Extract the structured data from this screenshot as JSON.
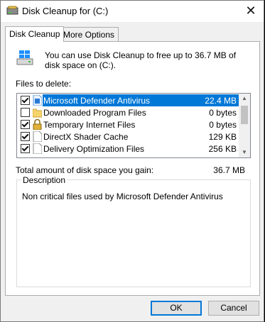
{
  "window": {
    "title": "Disk Cleanup for  (C:)"
  },
  "tabs": [
    {
      "label": "Disk Cleanup",
      "active": true
    },
    {
      "label": "More Options",
      "active": false
    }
  ],
  "intro": "You can use Disk Cleanup to free up to 36.7 MB of disk space on  (C:).",
  "files_label": "Files to delete:",
  "files": [
    {
      "name": "Microsoft Defender Antivirus",
      "size": "22.4 MB",
      "checked": true,
      "selected": true,
      "icon": "defender-file-icon"
    },
    {
      "name": "Downloaded Program Files",
      "size": "0 bytes",
      "checked": false,
      "selected": false,
      "icon": "folder-icon"
    },
    {
      "name": "Temporary Internet Files",
      "size": "0 bytes",
      "checked": true,
      "selected": false,
      "icon": "lock-icon"
    },
    {
      "name": "DirectX Shader Cache",
      "size": "129 KB",
      "checked": true,
      "selected": false,
      "icon": "file-icon"
    },
    {
      "name": "Delivery Optimization Files",
      "size": "256 KB",
      "checked": true,
      "selected": false,
      "icon": "file-icon"
    }
  ],
  "total": {
    "label": "Total amount of disk space you gain:",
    "value": "36.7 MB"
  },
  "description": {
    "legend": "Description",
    "text": "Non critical files used by Microsoft Defender Antivirus"
  },
  "buttons": {
    "ok": "OK",
    "cancel": "Cancel"
  },
  "colors": {
    "selection": "#0078d7",
    "default_button_border": "#0078d7"
  }
}
